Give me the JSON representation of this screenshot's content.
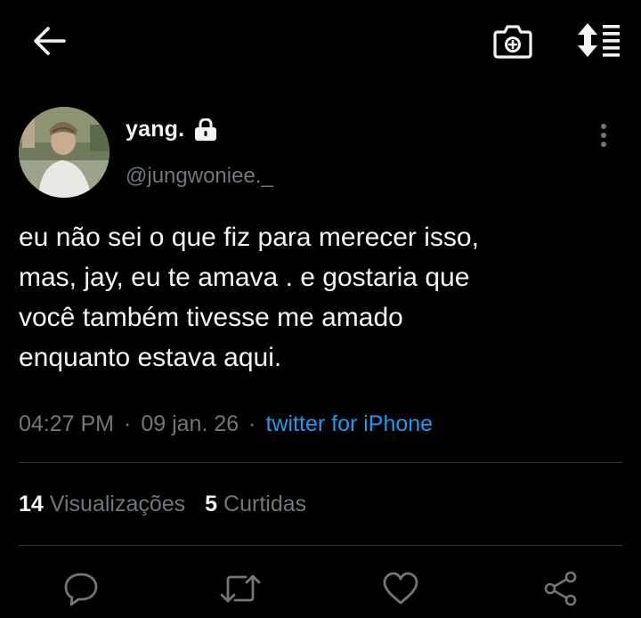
{
  "nav": {
    "back_icon": "arrow-left-icon",
    "camera_icon": "camera-icon",
    "sort_icon": "sort-list-icon"
  },
  "author": {
    "display_name": "yang.",
    "handle": "@jungwoniee._",
    "protected_icon": "lock-icon",
    "more_icon": "more-vertical-icon"
  },
  "tweet": {
    "lines": [
      "eu não sei o que fiz para merecer isso,",
      "mas, jay, eu te amava . e gostaria que",
      "você também tivesse me amado",
      "enquanto estava aqui."
    ],
    "time": "04:27 PM",
    "separator": "·",
    "date": "09 jan. 26",
    "source": "twitter for iPhone"
  },
  "stats": {
    "views_count": "14",
    "views_label": "Visualizações",
    "likes_count": "5",
    "likes_label": "Curtidas"
  },
  "actions": {
    "reply_icon": "reply-icon",
    "retweet_icon": "retweet-icon",
    "like_icon": "heart-icon",
    "share_icon": "share-icon"
  },
  "colors": {
    "background": "#000000",
    "text": "#f4f4f4",
    "muted": "#71767b",
    "link": "#1d9bf0",
    "divider": "#2f3336"
  }
}
